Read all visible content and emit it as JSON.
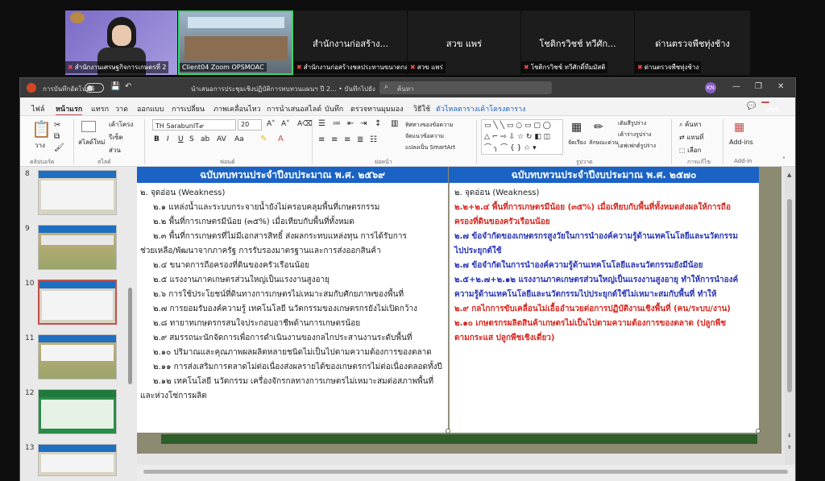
{
  "zoom": {
    "tiles": [
      {
        "name": "สำนักงานเศรษฐกิจการเกษตรที่ 2",
        "header": ""
      },
      {
        "name": "Client04 Zoom OPSMOAC",
        "header": ""
      },
      {
        "name": "สำนักงานก่อสร้างชลประทานขนาดกลา...",
        "header": "สำนักงานก่อสร้าง..."
      },
      {
        "name": "สวข แพร่",
        "header": "สวข แพร่"
      },
      {
        "name": "โชติกรวิชช์ ทวีศักดิ์ทีมมัสติ",
        "header": "โชติกรวิชช์ ทวีศัก..."
      },
      {
        "name": "ด่านตรวจพืชทุ่งช้าง",
        "header": "ด่านตรวจพืชทุ่งช้าง"
      }
    ]
  },
  "window": {
    "autosave_label": "การบันทึกอัตโนมัติ",
    "title": "นำเสนอการประชุมเชิงปฏิบัติการทบทวนแผนฯ ปี 2... • บันทึกไปยัง พีซีนี้",
    "search_placeholder": "ค้นหา",
    "user_initials": "KN"
  },
  "menu": {
    "tabs": [
      "ไฟล์",
      "หน้าแรก",
      "แทรก",
      "วาด",
      "ออกแบบ",
      "การเปลี่ยน",
      "ภาพเคลื่อนไหว",
      "การนำเสนอสไลด์",
      "บันทึก",
      "ตรวจทาน",
      "มุมมอง",
      "วิธีใช้",
      "ตัวไหลตาราง",
      "เค้าโครงตาราง"
    ],
    "share_label": "แชร์"
  },
  "ribbon": {
    "paste_label": "วาง",
    "clipboard_group": "คลิปบอร์ด",
    "new_slide_label": "สไลด์ใหม่",
    "slides_group": "สไลด์",
    "layout_label": "เค้าโครง",
    "reset_label": "รีเซ็ต",
    "section_label": "ส่วน",
    "font_name": "TH SarabunIT๙",
    "font_size": "20",
    "font_group": "ฟอนต์",
    "text_direction_label": "ทิศทางของข้อความ",
    "align_text_label": "จัดแนวข้อความ",
    "smartart_label": "แปลงเป็น SmartArt",
    "paragraph_group": "ย่อหน้า",
    "drawing_group": "รูปวาด",
    "arrange_label": "จัดเรียง",
    "quick_styles_label": "ลักษณะด่วน",
    "shape_fill_label": "เติมสีรูปร่าง",
    "shape_outline_label": "เค้าร่างรูปร่าง",
    "shape_effects_label": "เอฟเฟกต์รูปร่าง",
    "find_label": "ค้นหา",
    "replace_label": "แทนที่",
    "select_label": "เลือก",
    "editing_group": "การแก้ไข",
    "addins_label": "Add-ins",
    "addins_group": "Add-in"
  },
  "thumbnails": {
    "numbers": [
      "8",
      "9",
      "10",
      "11",
      "12",
      "13"
    ],
    "selected": "10"
  },
  "slide": {
    "left_header": "ฉบับทบทวนประจำปีงบประมาณ พ.ศ. ๒๕๖๙",
    "right_header": "ฉบับทบทวนประจำปีงบประมาณ พ.ศ. ๒๕๗๐",
    "left_title": "๒. จุดอ่อน (Weakness)",
    "left_items": [
      "๒.๑ แหล่งน้ำและระบบกระจายน้ำยังไม่ครอบคลุมพื้นที่เกษตรกรรม",
      "๒.๒ พื้นที่การเกษตรมีน้อย (๓๕%) เมื่อเทียบกับพื้นที่ทั้งหมด",
      "๒.๓ พื้นที่การเกษตรที่ไม่มีเอกสารสิทธิ์ ส่งผลกระทบแหล่งทุน การได้รับการ",
      "ช่วยเหลือ/พัฒนาจากภาครัฐ การรับรองมาตรฐานและการส่งออกสินค้า",
      "๒.๔ ขนาดการถือครองที่ดินของครัวเรือนน้อย",
      "๒.๕ แรงงานภาคเกษตรส่วนใหญ่เป็นแรงงานสูงอายุ",
      "๒.๖ การใช้ประโยชน์ที่ดินทางการเกษตรไม่เหมาะสมกับศักยภาพของพื้นที่",
      "๒.๗ การยอมรับองค์ความรู้ เทคโนโลยี นวัตกรรมของเกษตรกรยังไม่เปิดกว้าง",
      "๒.๘ ทายาทเกษตรกรสนใจประกอบอาชีพด้านการเกษตรน้อย",
      "๒.๙ สมรรถนะนักจัดการเพื่อการดำเนินงานของกลไกประสานงานระดับพื้นที่",
      "๒.๑๐ ปริมาณและคุณภาพผลผลิตหลายชนิดไม่เป็นไปตามความต้องการของตลาด",
      "๒.๑๑ การส่งเสริมการตลาดไม่ต่อเนื่องส่งผลรายได้ของเกษตรกรไม่ต่อเนื่องตลอดทั้งปี",
      "๒.๑๒ เทคโนโลยี นวัตกรรม เครื่องจักรกลทางการเกษตรไม่เหมาะสมต่อสภาพพื้นที่",
      "และห่วงโซ่การผลิต"
    ],
    "right_title": "๒. จุดอ่อน (Weakness)",
    "right_items": [
      {
        "text": "๒.๒+๒.๔ พื้นที่การเกษตรมีน้อย (๓๕%) เมื่อเทียบกับพื้นที่ทั้งหมดส่งผลให้การถือ",
        "color": "red"
      },
      {
        "text": "ครองที่ดินของครัวเรือนน้อย",
        "color": "red"
      },
      {
        "text": "๒.๗ ข้อจำกัดของเกษตรกรสูงวัยในการนำองค์ความรู้ด้านเทคโนโลยีและนวัตกรรม",
        "color": "blue"
      },
      {
        "text": "ไปประยุกต์ใช้",
        "color": "blue"
      },
      {
        "text": "๒.๗ ข้อจำกัดในการนำองค์ความรู้ด้านเทคโนโลยีและนวัตกรรมยังมีน้อย",
        "color": "blue"
      },
      {
        "text": "๒.๕+๒.๗+๒.๑๒ แรงงานภาคเกษตรส่วนใหญ่เป็นแรงงานสูงอายุ ทำให้การนำองค์",
        "color": "blue"
      },
      {
        "text": "ความรู้ด้านเทคโนโลยีและนวัตกรรมไปประยุกต์ใช้ไม่เหมาะสมกับพื้นที่ ทำให้",
        "color": "blue"
      },
      {
        "text": "๒.๙ กลไกการขับเคลื่อนไม่เอื้ออำนวยต่อการปฏิบัติงานเชิงพื้นที่ (คน/ระบบ/งาน)",
        "color": "red"
      },
      {
        "text": "๒.๑๐ เกษตรกรผลิตสินค้าเกษตรไม่เป็นไปตามความต้องการของตลาด (ปลูกพืช",
        "color": "red"
      },
      {
        "text": "ตามกระแส ปลูกพืชเชิงเดี่ยว)",
        "color": "red"
      }
    ]
  },
  "colors": {
    "header_blue": "#1a63c4",
    "red_text": "#d8261e",
    "blue_text": "#2935b5"
  }
}
